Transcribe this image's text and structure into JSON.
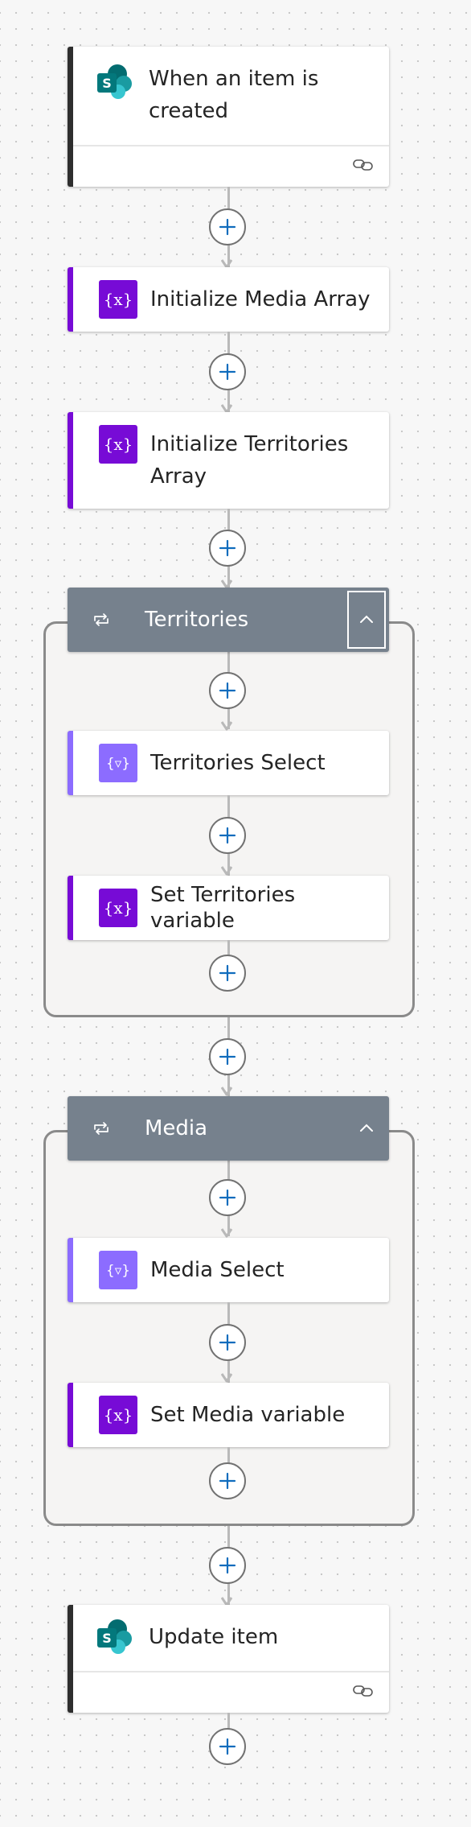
{
  "steps": {
    "trigger": {
      "title": "When an item is created",
      "icon": "sharepoint-icon"
    },
    "init_media": {
      "title": "Initialize Media Array",
      "icon": "variable-icon"
    },
    "init_territories": {
      "title": "Initialize Territories Array",
      "icon": "variable-icon"
    },
    "territories_loop": {
      "title": "Territories",
      "icon": "loop-icon",
      "actions": [
        {
          "title": "Territories Select",
          "icon": "data-operation-icon"
        },
        {
          "title": "Set Territories variable",
          "icon": "variable-icon"
        }
      ]
    },
    "media_loop": {
      "title": "Media",
      "icon": "loop-icon",
      "actions": [
        {
          "title": "Media Select",
          "icon": "data-operation-icon"
        },
        {
          "title": "Set Media variable",
          "icon": "variable-icon"
        }
      ]
    },
    "update": {
      "title": "Update item",
      "icon": "sharepoint-icon"
    }
  },
  "colors": {
    "sharepoint": "#038387",
    "variable": "#770bd6",
    "data_operation": "#8c6cff",
    "scope_header": "#76818d",
    "add_plus": "#0f6cbd"
  }
}
